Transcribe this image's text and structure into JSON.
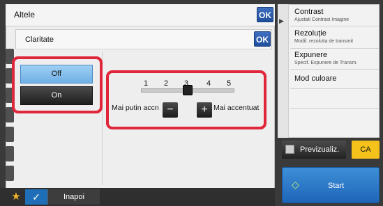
{
  "outer_panel": {
    "title": "Altele",
    "ok_label": "OK"
  },
  "dialog": {
    "title": "Claritate",
    "ok_label": "OK"
  },
  "toggle": {
    "off_label": "Off",
    "on_label": "On",
    "selected": "Off"
  },
  "slider": {
    "ticks": [
      "1",
      "2",
      "3",
      "4",
      "5"
    ],
    "value": 3,
    "min_label": "Mai putin accn",
    "max_label": "Mai accentuat",
    "minus_label": "−",
    "plus_label": "+"
  },
  "footer": {
    "back_label": "Inapoi",
    "star_icon": "star-icon",
    "check_icon": "check-icon"
  },
  "right_menu": {
    "items": [
      {
        "label": "Contrast",
        "sub": "Ajustati Contrast Imagine"
      },
      {
        "label": "Rezoluție",
        "sub": "Modif. rezolutia de transmit"
      },
      {
        "label": "Expunere",
        "sub": "Specif. Expunere de Transm."
      },
      {
        "label": "Mod culoare",
        "sub": ""
      }
    ]
  },
  "actions": {
    "preview_label": "Previzualiz.",
    "ca_label": "CA",
    "start_label": "Start"
  },
  "colors": {
    "highlight": "#e0263a",
    "accent_blue": "#1f65b8",
    "ca_yellow": "#f4c21a"
  }
}
